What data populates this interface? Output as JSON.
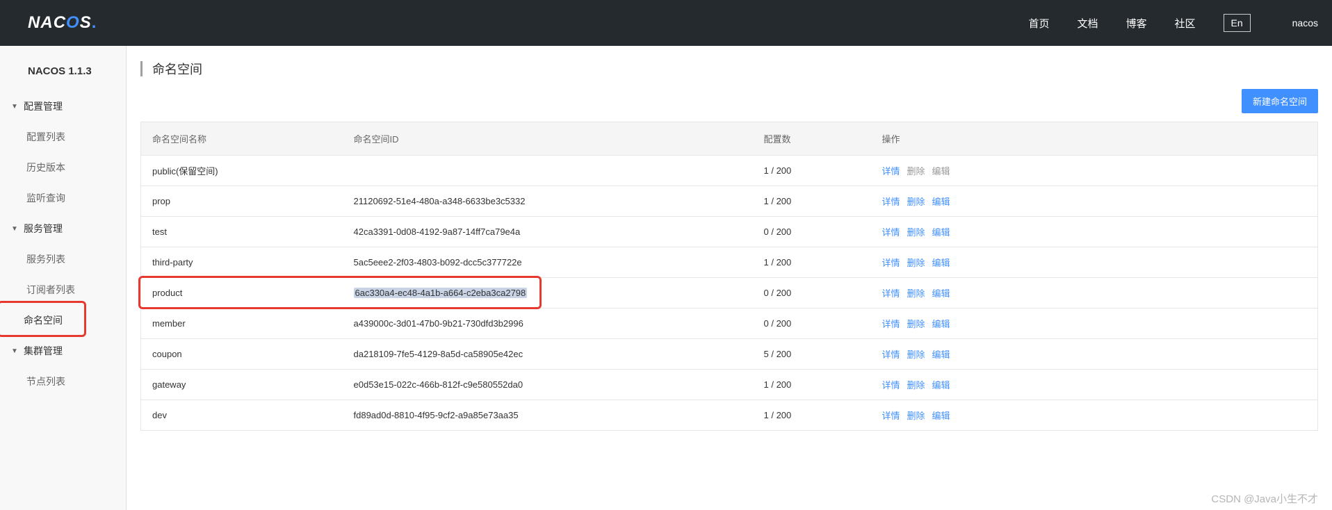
{
  "header": {
    "logo_text_n": "N",
    "logo_text_a": "A",
    "logo_text_c": "C",
    "logo_text_o1": "O",
    "logo_text_s": "S",
    "logo_dot": ".",
    "nav": {
      "home": "首页",
      "docs": "文档",
      "blog": "博客",
      "community": "社区"
    },
    "lang": "En",
    "username": "nacos"
  },
  "sidebar": {
    "title": "NACOS 1.1.3",
    "groups": {
      "config": {
        "label": "配置管理",
        "items": {
          "config_list": "配置列表",
          "history": "历史版本",
          "listen": "监听查询"
        }
      },
      "service": {
        "label": "服务管理",
        "items": {
          "service_list": "服务列表",
          "subscriber_list": "订阅者列表"
        }
      },
      "namespace": "命名空间",
      "cluster": {
        "label": "集群管理",
        "items": {
          "node_list": "节点列表"
        }
      }
    }
  },
  "main": {
    "page_title": "命名空间",
    "create_btn": "新建命名空间",
    "table": {
      "headers": {
        "name": "命名空间名称",
        "id": "命名空间ID",
        "count": "配置数",
        "operation": "操作"
      },
      "actions": {
        "details": "详情",
        "delete": "删除",
        "edit": "编辑"
      },
      "rows": [
        {
          "name": "public(保留空间)",
          "id": "",
          "count": "1 / 200",
          "muted": true
        },
        {
          "name": "prop",
          "id": "21120692-51e4-480a-a348-6633be3c5332",
          "count": "1 / 200",
          "muted": false
        },
        {
          "name": "test",
          "id": "42ca3391-0d08-4192-9a87-14ff7ca79e4a",
          "count": "0 / 200",
          "muted": false
        },
        {
          "name": "third-party",
          "id": "5ac5eee2-2f03-4803-b092-dcc5c377722e",
          "count": "1 / 200",
          "muted": false
        },
        {
          "name": "product",
          "id": "6ac330a4-ec48-4a1b-a664-c2eba3ca2798",
          "count": "0 / 200",
          "muted": false,
          "highlight": true
        },
        {
          "name": "member",
          "id": "a439000c-3d01-47b0-9b21-730dfd3b2996",
          "count": "0 / 200",
          "muted": false
        },
        {
          "name": "coupon",
          "id": "da218109-7fe5-4129-8a5d-ca58905e42ec",
          "count": "5 / 200",
          "muted": false
        },
        {
          "name": "gateway",
          "id": "e0d53e15-022c-466b-812f-c9e580552da0",
          "count": "1 / 200",
          "muted": false
        },
        {
          "name": "dev",
          "id": "fd89ad0d-8810-4f95-9cf2-a9a85e73aa35",
          "count": "1 / 200",
          "muted": false
        }
      ]
    }
  },
  "watermark": "CSDN @Java小生不才"
}
